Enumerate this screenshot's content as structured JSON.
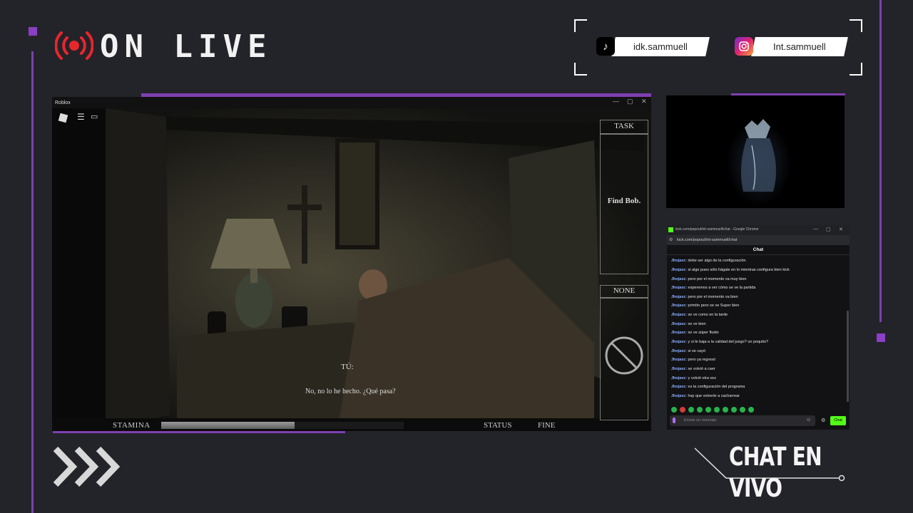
{
  "header": {
    "live_label": "ON LIVE"
  },
  "socials": [
    {
      "platform_icon": "tiktok-icon",
      "handle": "idk.sammuell"
    },
    {
      "platform_icon": "instagram-icon",
      "handle": "Int.sammuell"
    }
  ],
  "game_window": {
    "title": "Roblox",
    "controls": [
      "—",
      "▢",
      "✕"
    ],
    "hud": {
      "task_header": "TASK",
      "task_text": "Find Bob.",
      "item_header": "NONE",
      "stamina_label": "STAMINA",
      "stamina_level": 0.55,
      "status_label": "STATUS",
      "status_value": "FINE",
      "speaker": "TÚ:",
      "dialogue": "No, no lo he hecho. ¿Qué pasa?"
    }
  },
  "chat_window": {
    "browser_title": "kick.com/popout/int-sammuell/chat - Google Chrome",
    "url": "kick.com/popout/int-sammuell/chat",
    "heading": "Chat",
    "messages": [
      {
        "user": "Jhojaxc",
        "text": "debe ser algo de la configuración"
      },
      {
        "user": "Jhojaxc",
        "text": "si algo pues sólo hágale en lo mientras configura bien kick"
      },
      {
        "user": "Jhojaxc",
        "text": "pero por el momento va muy bien"
      },
      {
        "user": "Jhojaxc",
        "text": "esperemos a ver cómo se ve la partida"
      },
      {
        "user": "Jhojaxc",
        "text": "pero por el momento va bien"
      },
      {
        "user": "Jhojaxc",
        "text": "primito pero se ve Super bien"
      },
      {
        "user": "Jhojaxc",
        "text": "se ve como en la tarde"
      },
      {
        "user": "Jhojaxc",
        "text": "se ve bien"
      },
      {
        "user": "Jhojaxc",
        "text": "se ve súper fluido"
      },
      {
        "user": "Jhojaxc",
        "text": "y si le baja a la calidad del juego? un poquito?"
      },
      {
        "user": "Jhojaxc",
        "text": "si se cayó"
      },
      {
        "user": "Jhojaxc",
        "text": "pero ya regresó"
      },
      {
        "user": "Jhojaxc",
        "text": "se volvió a caer"
      },
      {
        "user": "Jhojaxc",
        "text": "y volvió otra vez"
      },
      {
        "user": "Jhojaxc",
        "text": "es la configuración del programa"
      },
      {
        "user": "Jhojaxc",
        "text": "hay que volverle a cacharrear"
      }
    ],
    "input_placeholder": "Enviar un mensaje",
    "send_label": "Chat"
  },
  "footer": {
    "chat_label": "CHAT EN VIVO"
  },
  "colors": {
    "accent": "#7e3fb0",
    "live_red": "#e8262d",
    "background": "#23232a",
    "send_green": "#53fc18"
  }
}
